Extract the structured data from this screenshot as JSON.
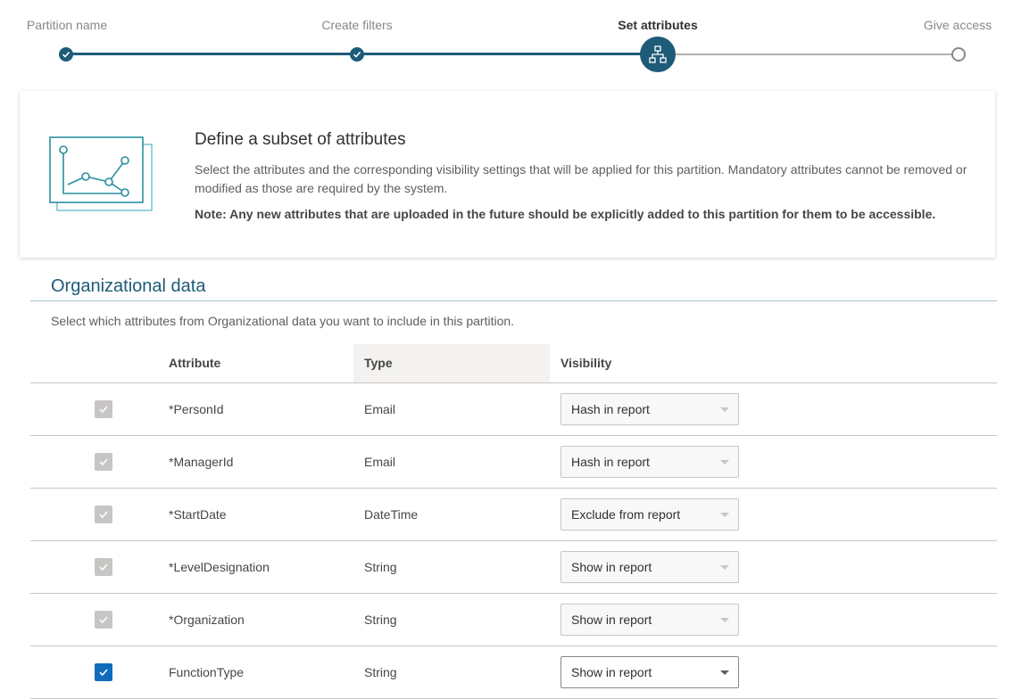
{
  "stepper": {
    "steps": [
      {
        "label": "Partition name",
        "state": "done"
      },
      {
        "label": "Create filters",
        "state": "done"
      },
      {
        "label": "Set attributes",
        "state": "current"
      },
      {
        "label": "Give access",
        "state": "pending"
      }
    ],
    "current_icon": "org-chart-icon",
    "done_icon": "check-icon"
  },
  "card": {
    "icon": "line-chart-illustration-icon",
    "title": "Define a subset of attributes",
    "description": "Select the attributes and the corresponding visibility settings that will be applied for this partition. Mandatory attributes cannot be removed or modified as those are required by the system.",
    "note": "Note: Any new attributes that are uploaded in the future should be explicitly added to this partition for them to be accessible."
  },
  "section": {
    "title": "Organizational data",
    "description": "Select which attributes from Organizational data you want to include in this partition."
  },
  "table": {
    "headers": {
      "attribute": "Attribute",
      "type": "Type",
      "visibility": "Visibility"
    },
    "rows": [
      {
        "attribute": "*PersonId",
        "type": "Email",
        "visibility": "Hash in report",
        "checked": true,
        "disabled": true
      },
      {
        "attribute": "*ManagerId",
        "type": "Email",
        "visibility": "Hash in report",
        "checked": true,
        "disabled": true
      },
      {
        "attribute": "*StartDate",
        "type": "DateTime",
        "visibility": "Exclude from report",
        "checked": true,
        "disabled": true
      },
      {
        "attribute": "*LevelDesignation",
        "type": "String",
        "visibility": "Show in report",
        "checked": true,
        "disabled": true
      },
      {
        "attribute": "*Organization",
        "type": "String",
        "visibility": "Show in report",
        "checked": true,
        "disabled": true
      },
      {
        "attribute": "FunctionType",
        "type": "String",
        "visibility": "Show in report",
        "checked": true,
        "disabled": false
      }
    ]
  },
  "colors": {
    "accent": "#1d5b78",
    "checkbox_on": "#0f6cbd",
    "checkbox_disabled": "#c8c6c4"
  }
}
